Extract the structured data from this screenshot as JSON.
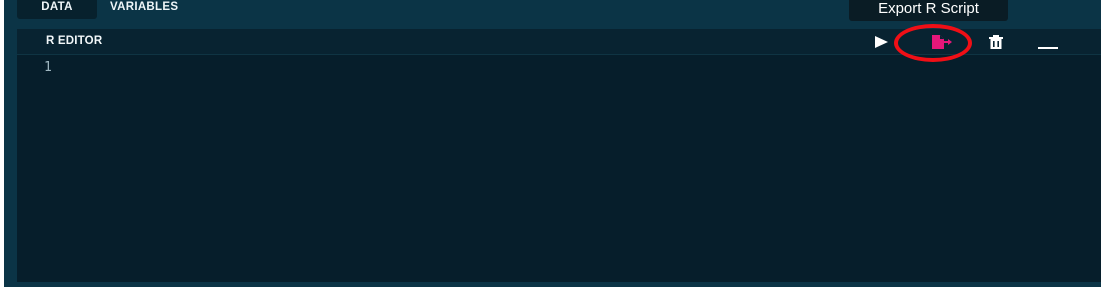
{
  "tabs": [
    {
      "label": "DATA",
      "active": true
    },
    {
      "label": "VARIABLES",
      "active": false
    }
  ],
  "tooltip": {
    "text": "Export R Script"
  },
  "editor": {
    "title": "R EDITOR",
    "line_numbers": [
      "1"
    ],
    "toolbar": [
      {
        "name": "run",
        "icon": "play-icon"
      },
      {
        "name": "export",
        "icon": "export-file-icon",
        "highlighted": true
      },
      {
        "name": "delete",
        "icon": "trash-icon"
      },
      {
        "name": "minimize",
        "icon": "minimize-icon"
      }
    ]
  },
  "colors": {
    "panel_bg": "#0b3446",
    "editor_bg": "#061e2b",
    "accent_export": "#e5177a",
    "highlight_ring": "#f00f16",
    "text": "#f2f7f9"
  }
}
